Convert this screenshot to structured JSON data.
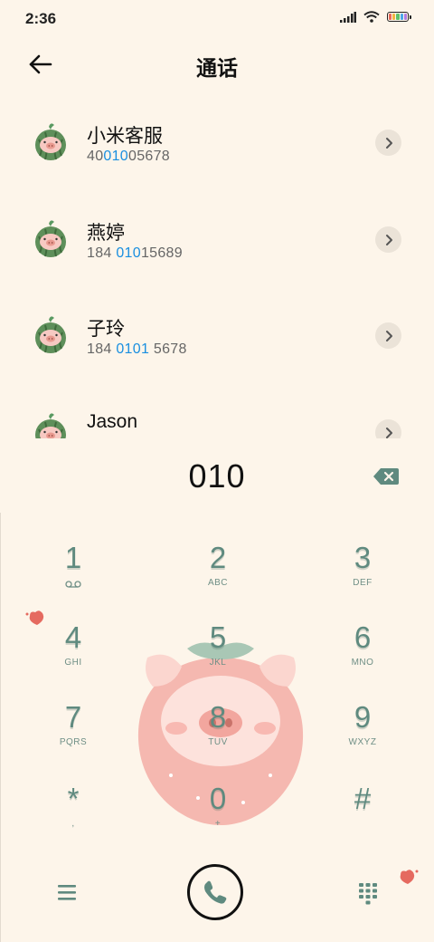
{
  "status": {
    "time": "2:36",
    "battery_colors": [
      "#e86a5a",
      "#f2b640",
      "#5fc16a",
      "#4aa8e8",
      "#b07ae0"
    ]
  },
  "header": {
    "title": "通话",
    "back_icon": "arrow-left-icon"
  },
  "contacts": [
    {
      "name": "小米客服",
      "num_pre": "40",
      "num_hl": "010",
      "num_post": "05678"
    },
    {
      "name": "燕婷",
      "num_pre": "184 ",
      "num_hl": "010",
      "num_post": "15689"
    },
    {
      "name": "子玲",
      "num_pre": "184 ",
      "num_hl": "0101",
      "num_post": " 5678"
    },
    {
      "name": "Jason",
      "num_pre": "",
      "num_hl": "",
      "num_post": ""
    }
  ],
  "dialer": {
    "digits": "010",
    "keys": [
      {
        "digit": "1",
        "letters": ""
      },
      {
        "digit": "2",
        "letters": "ABC"
      },
      {
        "digit": "3",
        "letters": "DEF"
      },
      {
        "digit": "4",
        "letters": "GHI"
      },
      {
        "digit": "5",
        "letters": "JKL"
      },
      {
        "digit": "6",
        "letters": "MNO"
      },
      {
        "digit": "7",
        "letters": "PQRS"
      },
      {
        "digit": "8",
        "letters": "TUV"
      },
      {
        "digit": "9",
        "letters": "WXYZ"
      },
      {
        "digit": "*",
        "letters": ","
      },
      {
        "digit": "0",
        "letters": "+"
      },
      {
        "digit": "#",
        "letters": ""
      }
    ]
  },
  "colors": {
    "accent_highlight": "#1a8fe0",
    "key_color": "#5f8a7f",
    "background": "#fdf5ea"
  }
}
